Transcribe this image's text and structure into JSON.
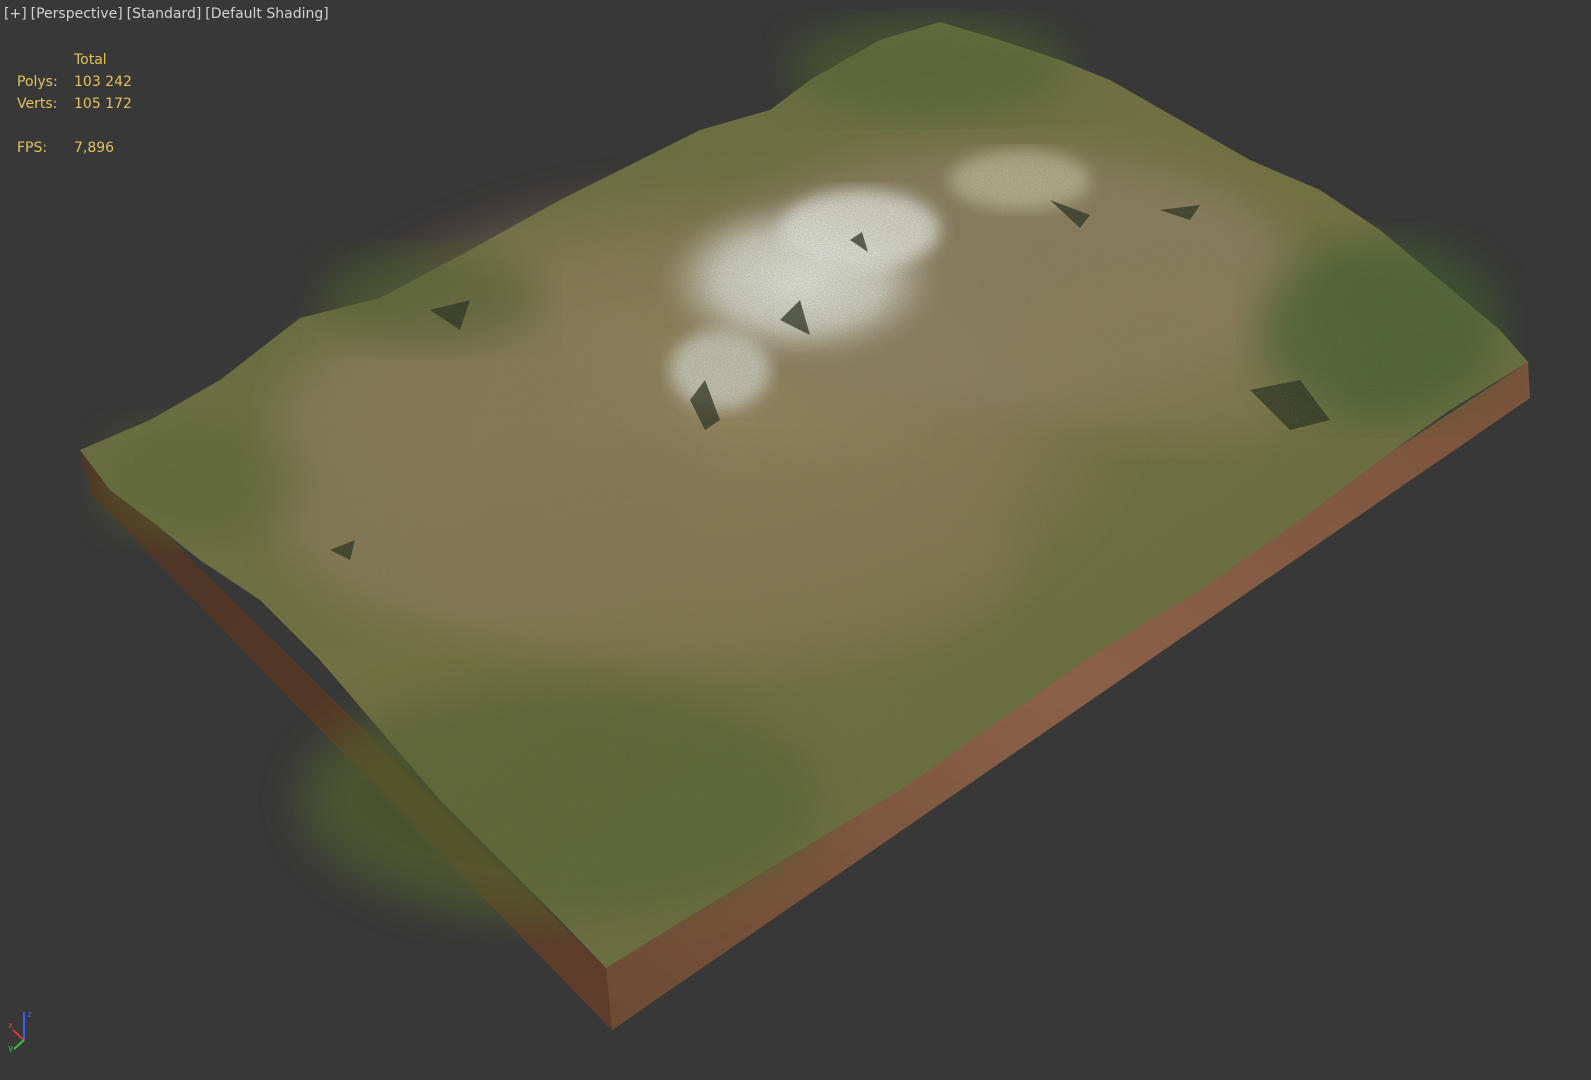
{
  "viewport": {
    "labels": [
      "[+]",
      "[Perspective]",
      "[Standard]",
      "[Default Shading]"
    ]
  },
  "stats": {
    "header": "Total",
    "polys_label": "Polys:",
    "polys_value": "103 242",
    "verts_label": "Verts:",
    "verts_value": "105 172",
    "fps_label": "FPS:",
    "fps_value": "7,896"
  },
  "gizmo": {
    "axes": [
      "x",
      "y",
      "z"
    ]
  },
  "colors": {
    "background": "#383838",
    "label_text": "#d2d2d2",
    "stats_text": "#e3c25a",
    "terrain_grass": "#6a6a3c",
    "terrain_dry": "#8e7b5a",
    "snow": "#e6e6e6",
    "soil_side": "#6b4a35"
  }
}
